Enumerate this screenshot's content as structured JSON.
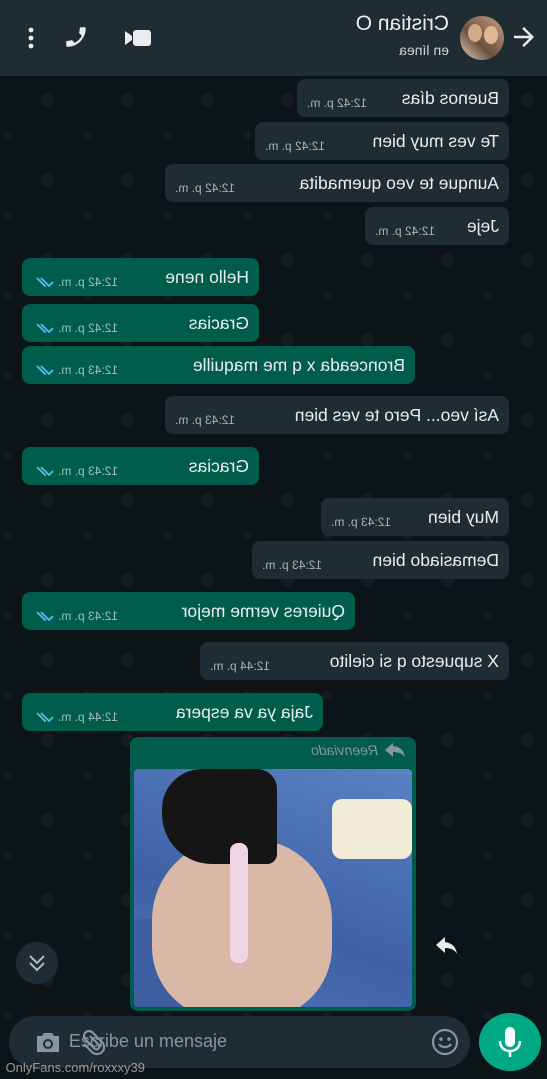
{
  "header": {
    "contact_name": "Cristian O",
    "status": "en línea"
  },
  "messages": [
    {
      "text": "Buenos días",
      "time": "12:42 p. m.",
      "direction": "incoming"
    },
    {
      "text": "Te ves muy bien",
      "time": "12:42 p. m.",
      "direction": "incoming"
    },
    {
      "text": "Aunque te veo quemadita",
      "time": "12:42 p. m.",
      "direction": "incoming"
    },
    {
      "text": "Jeje",
      "time": "12:42 p. m.",
      "direction": "incoming"
    },
    {
      "text": "Hello nene",
      "time": "12:42 p. m.",
      "direction": "outgoing"
    },
    {
      "text": "Gracias",
      "time": "12:42 p. m.",
      "direction": "outgoing"
    },
    {
      "text": "Bronceada x q me maquille",
      "time": "12:43 p. m.",
      "direction": "outgoing"
    },
    {
      "text": "Así veo... Pero te ves bien",
      "time": "12:43 p. m.",
      "direction": "incoming"
    },
    {
      "text": "Gracias",
      "time": "12:43 p. m.",
      "direction": "outgoing"
    },
    {
      "text": "Muy bien",
      "time": "12:43 p. m.",
      "direction": "incoming"
    },
    {
      "text": "Demasiado bien",
      "time": "12:43 p. m.",
      "direction": "incoming"
    },
    {
      "text": "Quieres verme mejor",
      "time": "12:43 p. m.",
      "direction": "outgoing"
    },
    {
      "text": "X supuesto q si cielito",
      "time": "12:44 p. m.",
      "direction": "incoming"
    },
    {
      "text": "Jaja ya va espera",
      "time": "12:44 p. m.",
      "direction": "outgoing"
    }
  ],
  "forwarded": {
    "label": "Reenviado"
  },
  "composer": {
    "placeholder": "Escribe un mensaje"
  },
  "watermark": "OnlyFans.com/roxxxy39",
  "colors": {
    "header_bg": "#1f2c34",
    "incoming_bubble": "#1f2c34",
    "outgoing_bubble": "#005c4b",
    "accent": "#00a884"
  }
}
